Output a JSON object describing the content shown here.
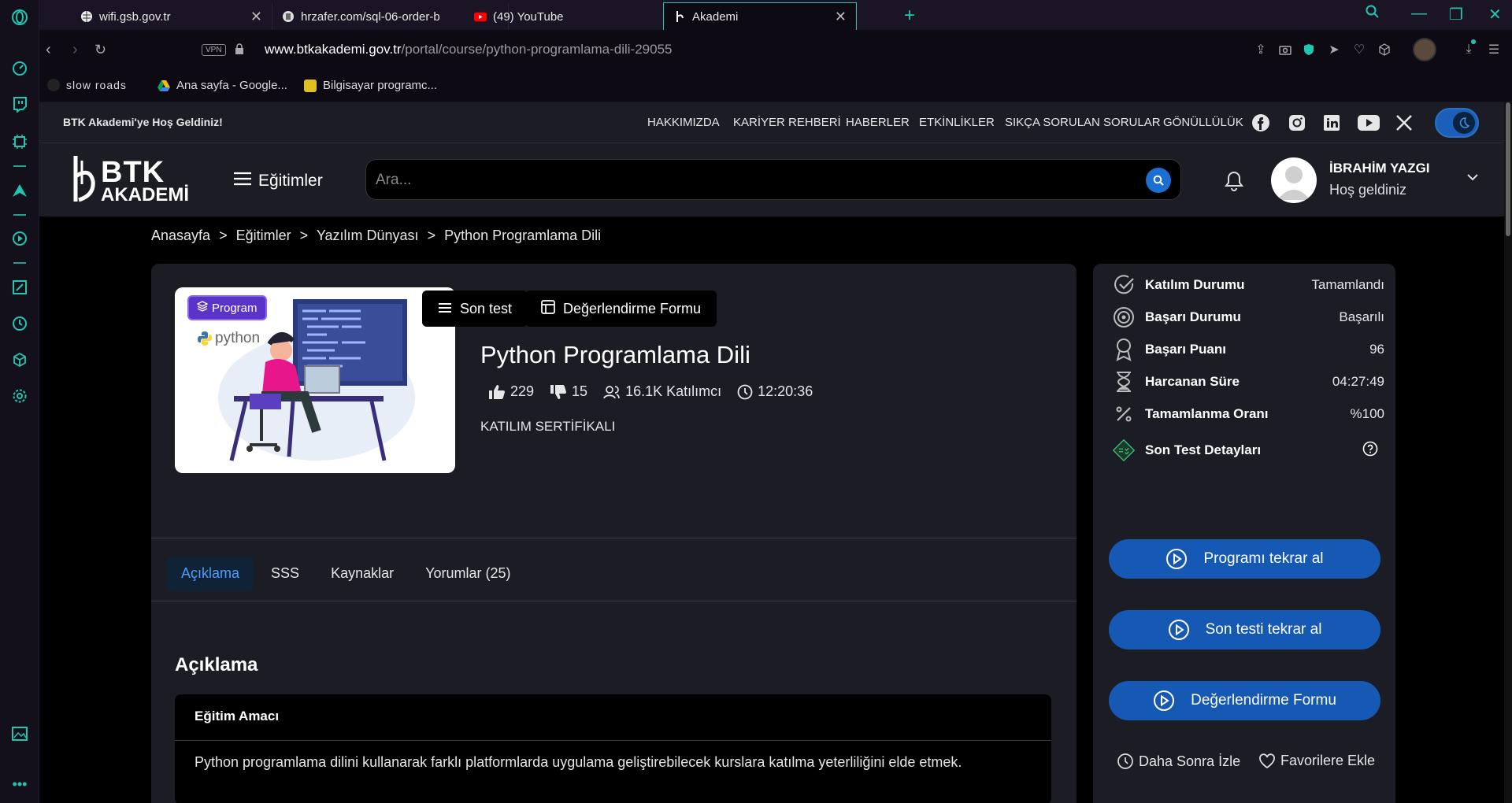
{
  "browser": {
    "tabs": [
      {
        "title": "wifi.gsb.gov.tr",
        "favicon": "globe-icon"
      },
      {
        "title": "hrzafer.com/sql-06-order-b",
        "favicon": "doc-icon"
      },
      {
        "title": "(49) YouTube",
        "favicon": "youtube-icon"
      },
      {
        "title": "Akademi",
        "favicon": "btk-icon"
      }
    ],
    "vpn_label": "VPN",
    "url_host": "www.btkakademi.gov.tr",
    "url_path": "/portal/course/python-programlama-dili-29055",
    "bookmarks": [
      {
        "label": "slow roads",
        "icon": "bookmark-icon"
      },
      {
        "label": "Ana sayfa - Google...",
        "icon": "drive-icon"
      },
      {
        "label": "Bilgisayar programc...",
        "icon": "bookmark-icon"
      }
    ]
  },
  "site": {
    "welcome": "BTK Akademi'ye Hoş Geldiniz!",
    "top_nav": [
      "HAKKIMIZDA",
      "KARİYER REHBERİ",
      "HABERLER",
      "ETKİNLİKLER",
      "SIKÇA SORULAN SORULAR",
      "GÖNÜLLÜLÜK"
    ],
    "social": [
      "facebook-icon",
      "instagram-icon",
      "linkedin-icon",
      "youtube-icon",
      "x-icon"
    ],
    "logo_top": "BTK",
    "logo_bottom": "AKADEMİ",
    "menu_label": "Eğitimler",
    "search_placeholder": "Ara...",
    "user_name": "İBRAHİM YAZGI",
    "user_greeting": "Hoş geldiniz"
  },
  "breadcrumb": [
    "Anasayfa",
    "Eğitimler",
    "Yazılım Dünyası",
    "Python Programlama Dili"
  ],
  "breadcrumb_sep": ">",
  "course": {
    "badge": "Program",
    "thumb_text": "python",
    "btn_last_test": "Son test",
    "btn_eval_form": "Değerlendirme Formu",
    "title": "Python Programlama Dili",
    "likes": "229",
    "dislikes": "15",
    "participants": "16.1K Katılımcı",
    "duration": "12:20:36",
    "certificate": "KATILIM SERTİFİKALI",
    "tabs": [
      "Açıklama",
      "SSS",
      "Kaynaklar",
      "Yorumlar (25)"
    ],
    "section_title": "Açıklama",
    "box_title": "Eğitim Amacı",
    "box_text": "Python programlama dilini kullanarak farklı platformlarda uygulama geliştirebilecek kurslara katılma yeterliliğini elde etmek."
  },
  "sidebar": {
    "rows": [
      {
        "label": "Katılım Durumu",
        "value": "Tamamlandı",
        "icon": "check-circle-icon"
      },
      {
        "label": "Başarı Durumu",
        "value": "Başarılı",
        "icon": "target-icon"
      },
      {
        "label": "Başarı Puanı",
        "value": "96",
        "icon": "award-icon"
      },
      {
        "label": "Harcanan Süre",
        "value": "04:27:49",
        "icon": "hourglass-icon"
      },
      {
        "label": "Tamamlanma Oranı",
        "value": "%100",
        "icon": "percent-icon"
      },
      {
        "label": "Son Test Detayları",
        "value": "",
        "icon": "test-icon"
      }
    ],
    "buttons": [
      "Programı tekrar al",
      "Son testi tekrar al",
      "Değerlendirme Formu"
    ],
    "watch_later": "Daha Sonra İzle",
    "favorites": "Favorilere Ekle"
  },
  "colors": {
    "accent": "#1fc7b0",
    "primary_button": "#1559b4",
    "panel": "#1c1d24"
  }
}
